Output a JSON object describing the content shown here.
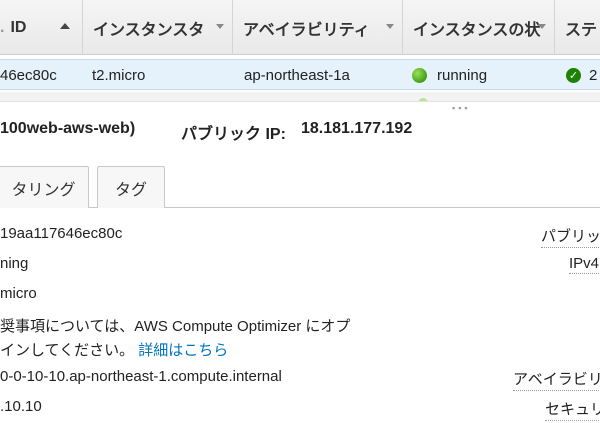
{
  "table": {
    "columns": [
      {
        "label": "ID"
      },
      {
        "label": "インスタンスタ"
      },
      {
        "label": "アベイラビリティ"
      },
      {
        "label": "インスタンスの状"
      },
      {
        "label": "ステ"
      }
    ],
    "row": {
      "instance_id": "46ec80c",
      "instance_type": "t2.micro",
      "availability_zone": "ap-northeast-1a",
      "state": "running",
      "status_check": "2"
    }
  },
  "detail": {
    "instance_name": "100web-aws-web)",
    "public_ip_label": "パブリック IP:",
    "public_ip_value": "18.181.177.192",
    "tabs": [
      {
        "label": "タリング"
      },
      {
        "label": "タグ"
      }
    ],
    "left": {
      "instance_id": "19aa117646ec80c",
      "state": "ning",
      "type": "micro",
      "optimizer_text": "奨事項については、AWS Compute Optimizer にオプ",
      "optimizer_text2": "インしてください。",
      "optimizer_link": "詳細はこちら",
      "private_dns": "0-0-10-10.ap-northeast-1.compute.internal",
      "private_ip": ".10.10"
    },
    "right": {
      "public_label": "パブリッ",
      "ipv4_label": "IPv4",
      "az_label": "アベイラビリ",
      "security_label": "セキュリ"
    }
  },
  "colors": {
    "selected_row": "#e5f1fb",
    "running": "#3fa014",
    "link": "#0073bb",
    "check": "#1d8102"
  }
}
